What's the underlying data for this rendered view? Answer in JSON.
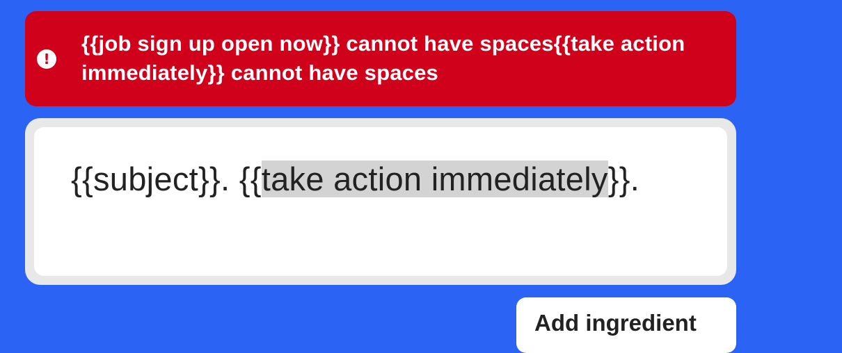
{
  "error": {
    "icon": "alert-circle-icon",
    "icon_glyph": "!",
    "message": "{{job sign up open now}} cannot have spaces{{take action immediately}} cannot have spaces",
    "color": "#d0021b"
  },
  "editor": {
    "part1": "{{subject}}. {{",
    "highlight": "take action immediately",
    "part2": "}}."
  },
  "actions": {
    "add_ingredient_label": "Add ingredient"
  },
  "colors": {
    "background": "#2b63f5",
    "highlight": "#d3d3d3"
  }
}
